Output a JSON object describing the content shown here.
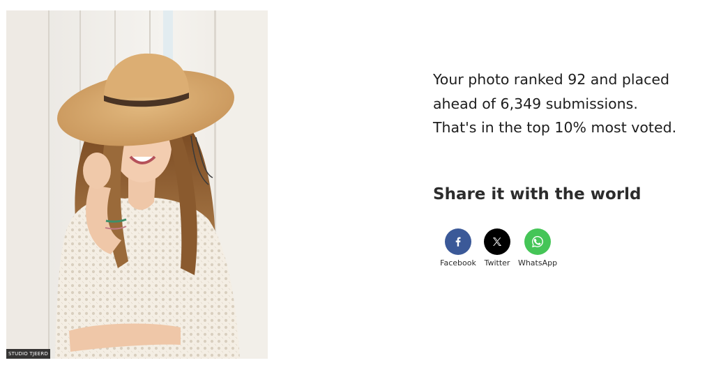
{
  "photo": {
    "alt": "Girl in a wide straw hat and white crochet top",
    "watermark": "STUDIO TJEERD"
  },
  "result": {
    "line1": "Your photo ranked 92 and placed",
    "line2": "ahead of 6,349 submissions.",
    "line3": "That's in the top 10% most voted."
  },
  "share": {
    "heading": "Share it with the world",
    "buttons": [
      {
        "label": "Facebook",
        "icon": "facebook-icon",
        "color": "#3b5998"
      },
      {
        "label": "Twitter",
        "icon": "x-twitter-icon",
        "color": "#000000"
      },
      {
        "label": "WhatsApp",
        "icon": "whatsapp-icon",
        "color": "#45c557"
      }
    ]
  }
}
